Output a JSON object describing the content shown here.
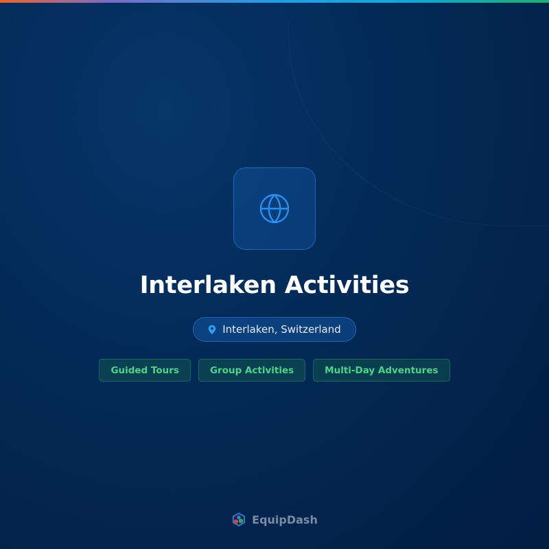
{
  "header": {
    "title": "Interlaken Activities"
  },
  "location": {
    "label": "Interlaken, Switzerland",
    "icon": "map-pin-icon"
  },
  "tags": [
    {
      "label": "Guided Tours"
    },
    {
      "label": "Group Activities"
    },
    {
      "label": "Multi-Day Adventures"
    }
  ],
  "hero_icon": "globe-icon",
  "brand": {
    "name": "EquipDash",
    "icon": "equipdash-logo-icon"
  },
  "colors": {
    "accent_blue": "#2a8ff0",
    "tag_green": "#4fd38a",
    "background": "#042b58"
  }
}
